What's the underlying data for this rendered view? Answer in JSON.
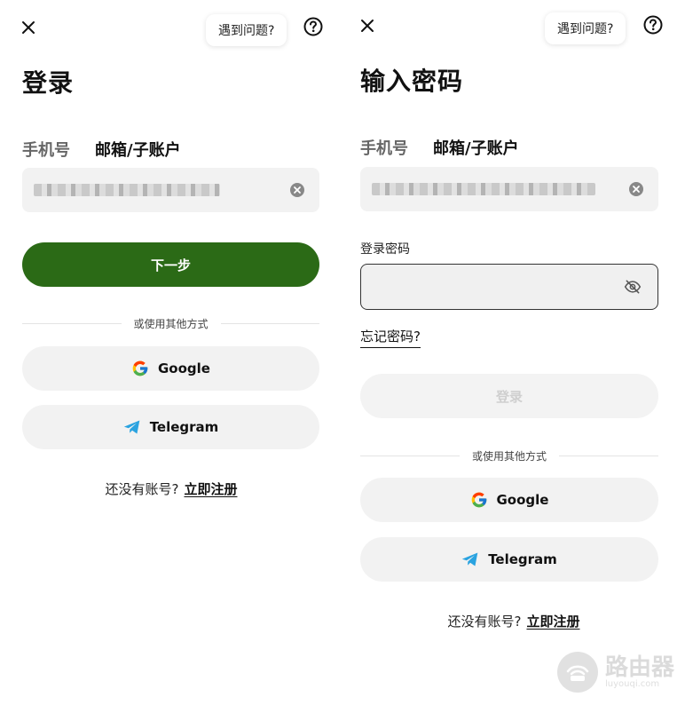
{
  "left": {
    "help_text": "遇到问题?",
    "title": "登录",
    "tabs": [
      {
        "label": "手机号",
        "active": false
      },
      {
        "label": "邮箱/子账户",
        "active": true
      }
    ],
    "next_button": "下一步",
    "divider_text": "或使用其他方式",
    "google_label": "Google",
    "telegram_label": "Telegram",
    "signup_prompt": "还没有账号?",
    "signup_link": "立即注册"
  },
  "right": {
    "help_text": "遇到问题?",
    "title": "输入密码",
    "tabs": [
      {
        "label": "手机号",
        "active": false
      },
      {
        "label": "邮箱/子账户",
        "active": true
      }
    ],
    "password_label": "登录密码",
    "forgot_link": "忘记密码?",
    "login_button": "登录",
    "divider_text": "或使用其他方式",
    "google_label": "Google",
    "telegram_label": "Telegram",
    "signup_prompt": "还没有账号?",
    "signup_link": "立即注册"
  },
  "watermark": {
    "main": "路由器",
    "sub": "luyouqi.com"
  },
  "colors": {
    "primary_button": "#2b6a16",
    "input_bg": "#f2f2f2",
    "telegram": "#2aa3e0"
  },
  "icons": [
    "close-icon",
    "help-icon",
    "clear-icon",
    "eye-off-icon",
    "google-icon",
    "telegram-icon",
    "router-logo-icon"
  ]
}
